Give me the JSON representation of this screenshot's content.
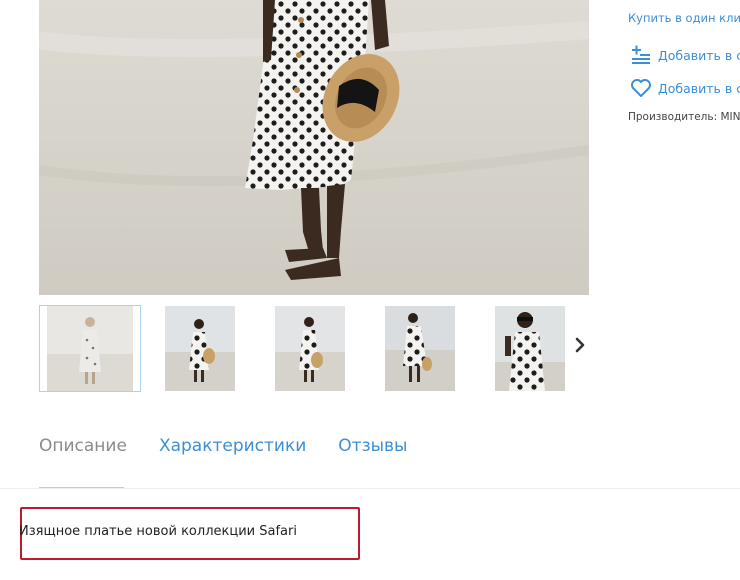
{
  "product": {
    "main_photo_icon": "woman-polka-dot-dress-beach-photo",
    "thumbnails": [
      {
        "icon": "photo-full-length-front",
        "active": true
      },
      {
        "icon": "photo-full-length-hat"
      },
      {
        "icon": "photo-full-length-side"
      },
      {
        "icon": "photo-full-length-walking"
      },
      {
        "icon": "photo-closeup-sunglasses"
      }
    ],
    "next_icon": "chevron-right-icon"
  },
  "side": {
    "buy_one_click": "Купить в один клик",
    "add_to_compare": "Добавить в сравнение",
    "add_to_favorites": "Добавить в список желаний",
    "manufacturer": "Производитель: MINA",
    "compare_icon": "list-add-icon",
    "favorites_icon": "heart-icon"
  },
  "tabs": [
    {
      "label": "Описание",
      "active": true
    },
    {
      "label": "Характеристики"
    },
    {
      "label": "Отзывы"
    }
  ],
  "description": {
    "text": "Изящное платье новой коллекции Safari"
  },
  "colors": {
    "accent": "#3a8fd6",
    "highlight": "#c0182f",
    "tab_inactive": "#8a8a8a"
  }
}
